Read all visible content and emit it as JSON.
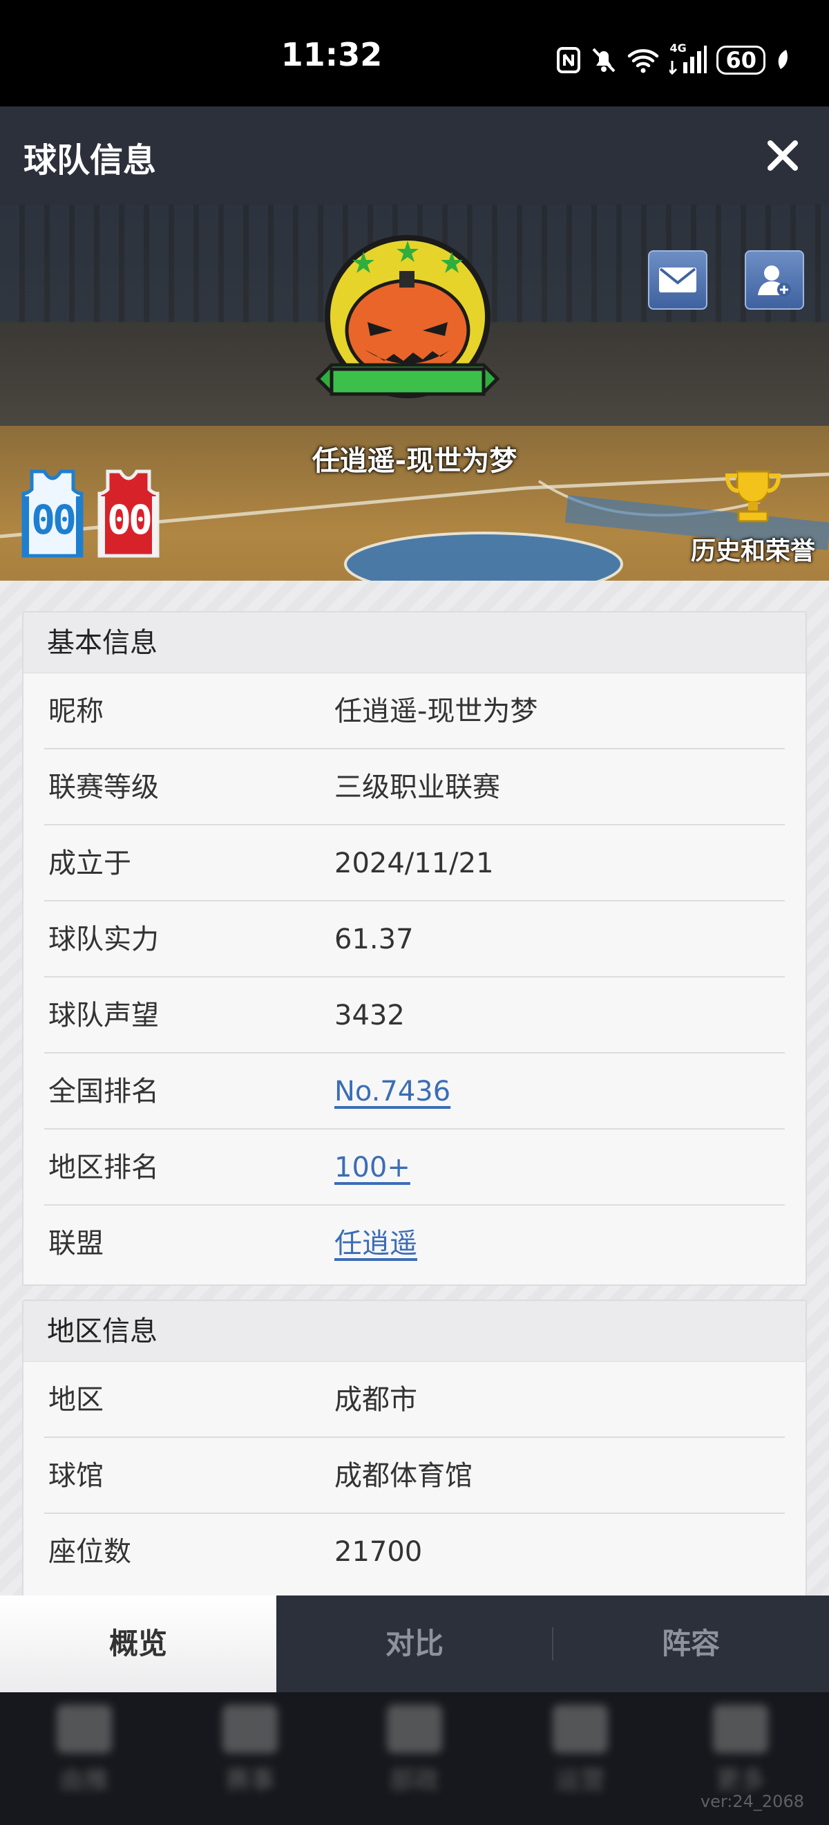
{
  "status_bar": {
    "time": "11:32",
    "battery": "60",
    "network": "4G",
    "icons": [
      "nfc-icon",
      "mute-icon",
      "wifi-icon",
      "signal-icon",
      "battery-icon",
      "leaf-icon"
    ]
  },
  "header": {
    "title": "球队信息",
    "close_icon": "close-icon"
  },
  "hero": {
    "team_name": "任逍遥-现世为梦",
    "home_jersey_number": "00",
    "away_jersey_number": "00",
    "history_label": "历史和荣誉",
    "mail_icon": "mail-icon",
    "add_friend_icon": "add-friend-icon",
    "trophy_icon": "trophy-icon"
  },
  "basic_info": {
    "title": "基本信息",
    "rows": [
      {
        "label": "昵称",
        "value": "任逍遥-现世为梦"
      },
      {
        "label": "联赛等级",
        "value": "三级职业联赛"
      },
      {
        "label": "成立于",
        "value": "2024/11/21"
      },
      {
        "label": "球队实力",
        "value": "61.37"
      },
      {
        "label": "球队声望",
        "value": "3432"
      },
      {
        "label": "全国排名",
        "value": "No.7436"
      },
      {
        "label": "地区排名",
        "value": "100+"
      },
      {
        "label": "联盟",
        "value": "任逍遥"
      }
    ]
  },
  "region_info": {
    "title": "地区信息",
    "rows": [
      {
        "label": "地区",
        "value": "成都市"
      },
      {
        "label": "球馆",
        "value": "成都体育馆"
      },
      {
        "label": "座位数",
        "value": "21700"
      }
    ]
  },
  "tabs": [
    {
      "label": "概览",
      "active": true
    },
    {
      "label": "对比",
      "active": false
    },
    {
      "label": "阵容",
      "active": false
    }
  ],
  "bottom_nav": [
    "由推",
    "赛事",
    "部政",
    "运营",
    "更多"
  ],
  "version": "ver:24_2068",
  "colors": {
    "header_bg": "#2b303b",
    "link": "#3b6db5",
    "home_jersey": "#1e7fd0",
    "away_jersey": "#d8222a"
  }
}
